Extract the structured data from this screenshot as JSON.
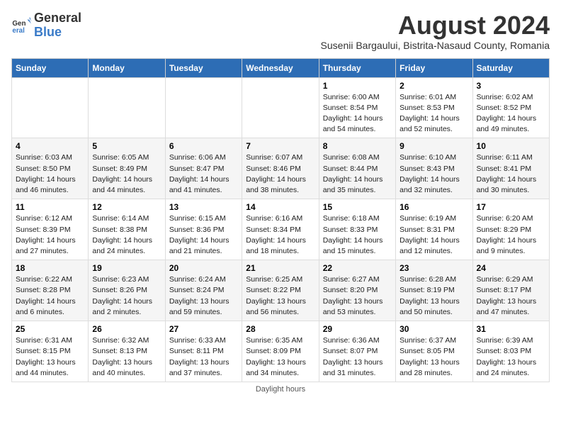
{
  "logo": {
    "general": "General",
    "blue": "Blue"
  },
  "title": "August 2024",
  "subtitle": "Susenii Bargaului, Bistrita-Nasaud County, Romania",
  "days_of_week": [
    "Sunday",
    "Monday",
    "Tuesday",
    "Wednesday",
    "Thursday",
    "Friday",
    "Saturday"
  ],
  "footer": "Daylight hours",
  "weeks": [
    [
      {
        "day": "",
        "sunrise": "",
        "sunset": "",
        "daylight": ""
      },
      {
        "day": "",
        "sunrise": "",
        "sunset": "",
        "daylight": ""
      },
      {
        "day": "",
        "sunrise": "",
        "sunset": "",
        "daylight": ""
      },
      {
        "day": "",
        "sunrise": "",
        "sunset": "",
        "daylight": ""
      },
      {
        "day": "1",
        "sunrise": "6:00 AM",
        "sunset": "8:54 PM",
        "daylight": "14 hours and 54 minutes."
      },
      {
        "day": "2",
        "sunrise": "6:01 AM",
        "sunset": "8:53 PM",
        "daylight": "14 hours and 52 minutes."
      },
      {
        "day": "3",
        "sunrise": "6:02 AM",
        "sunset": "8:52 PM",
        "daylight": "14 hours and 49 minutes."
      }
    ],
    [
      {
        "day": "4",
        "sunrise": "6:03 AM",
        "sunset": "8:50 PM",
        "daylight": "14 hours and 46 minutes."
      },
      {
        "day": "5",
        "sunrise": "6:05 AM",
        "sunset": "8:49 PM",
        "daylight": "14 hours and 44 minutes."
      },
      {
        "day": "6",
        "sunrise": "6:06 AM",
        "sunset": "8:47 PM",
        "daylight": "14 hours and 41 minutes."
      },
      {
        "day": "7",
        "sunrise": "6:07 AM",
        "sunset": "8:46 PM",
        "daylight": "14 hours and 38 minutes."
      },
      {
        "day": "8",
        "sunrise": "6:08 AM",
        "sunset": "8:44 PM",
        "daylight": "14 hours and 35 minutes."
      },
      {
        "day": "9",
        "sunrise": "6:10 AM",
        "sunset": "8:43 PM",
        "daylight": "14 hours and 32 minutes."
      },
      {
        "day": "10",
        "sunrise": "6:11 AM",
        "sunset": "8:41 PM",
        "daylight": "14 hours and 30 minutes."
      }
    ],
    [
      {
        "day": "11",
        "sunrise": "6:12 AM",
        "sunset": "8:39 PM",
        "daylight": "14 hours and 27 minutes."
      },
      {
        "day": "12",
        "sunrise": "6:14 AM",
        "sunset": "8:38 PM",
        "daylight": "14 hours and 24 minutes."
      },
      {
        "day": "13",
        "sunrise": "6:15 AM",
        "sunset": "8:36 PM",
        "daylight": "14 hours and 21 minutes."
      },
      {
        "day": "14",
        "sunrise": "6:16 AM",
        "sunset": "8:34 PM",
        "daylight": "14 hours and 18 minutes."
      },
      {
        "day": "15",
        "sunrise": "6:18 AM",
        "sunset": "8:33 PM",
        "daylight": "14 hours and 15 minutes."
      },
      {
        "day": "16",
        "sunrise": "6:19 AM",
        "sunset": "8:31 PM",
        "daylight": "14 hours and 12 minutes."
      },
      {
        "day": "17",
        "sunrise": "6:20 AM",
        "sunset": "8:29 PM",
        "daylight": "14 hours and 9 minutes."
      }
    ],
    [
      {
        "day": "18",
        "sunrise": "6:22 AM",
        "sunset": "8:28 PM",
        "daylight": "14 hours and 6 minutes."
      },
      {
        "day": "19",
        "sunrise": "6:23 AM",
        "sunset": "8:26 PM",
        "daylight": "14 hours and 2 minutes."
      },
      {
        "day": "20",
        "sunrise": "6:24 AM",
        "sunset": "8:24 PM",
        "daylight": "13 hours and 59 minutes."
      },
      {
        "day": "21",
        "sunrise": "6:25 AM",
        "sunset": "8:22 PM",
        "daylight": "13 hours and 56 minutes."
      },
      {
        "day": "22",
        "sunrise": "6:27 AM",
        "sunset": "8:20 PM",
        "daylight": "13 hours and 53 minutes."
      },
      {
        "day": "23",
        "sunrise": "6:28 AM",
        "sunset": "8:19 PM",
        "daylight": "13 hours and 50 minutes."
      },
      {
        "day": "24",
        "sunrise": "6:29 AM",
        "sunset": "8:17 PM",
        "daylight": "13 hours and 47 minutes."
      }
    ],
    [
      {
        "day": "25",
        "sunrise": "6:31 AM",
        "sunset": "8:15 PM",
        "daylight": "13 hours and 44 minutes."
      },
      {
        "day": "26",
        "sunrise": "6:32 AM",
        "sunset": "8:13 PM",
        "daylight": "13 hours and 40 minutes."
      },
      {
        "day": "27",
        "sunrise": "6:33 AM",
        "sunset": "8:11 PM",
        "daylight": "13 hours and 37 minutes."
      },
      {
        "day": "28",
        "sunrise": "6:35 AM",
        "sunset": "8:09 PM",
        "daylight": "13 hours and 34 minutes."
      },
      {
        "day": "29",
        "sunrise": "6:36 AM",
        "sunset": "8:07 PM",
        "daylight": "13 hours and 31 minutes."
      },
      {
        "day": "30",
        "sunrise": "6:37 AM",
        "sunset": "8:05 PM",
        "daylight": "13 hours and 28 minutes."
      },
      {
        "day": "31",
        "sunrise": "6:39 AM",
        "sunset": "8:03 PM",
        "daylight": "13 hours and 24 minutes."
      }
    ]
  ]
}
